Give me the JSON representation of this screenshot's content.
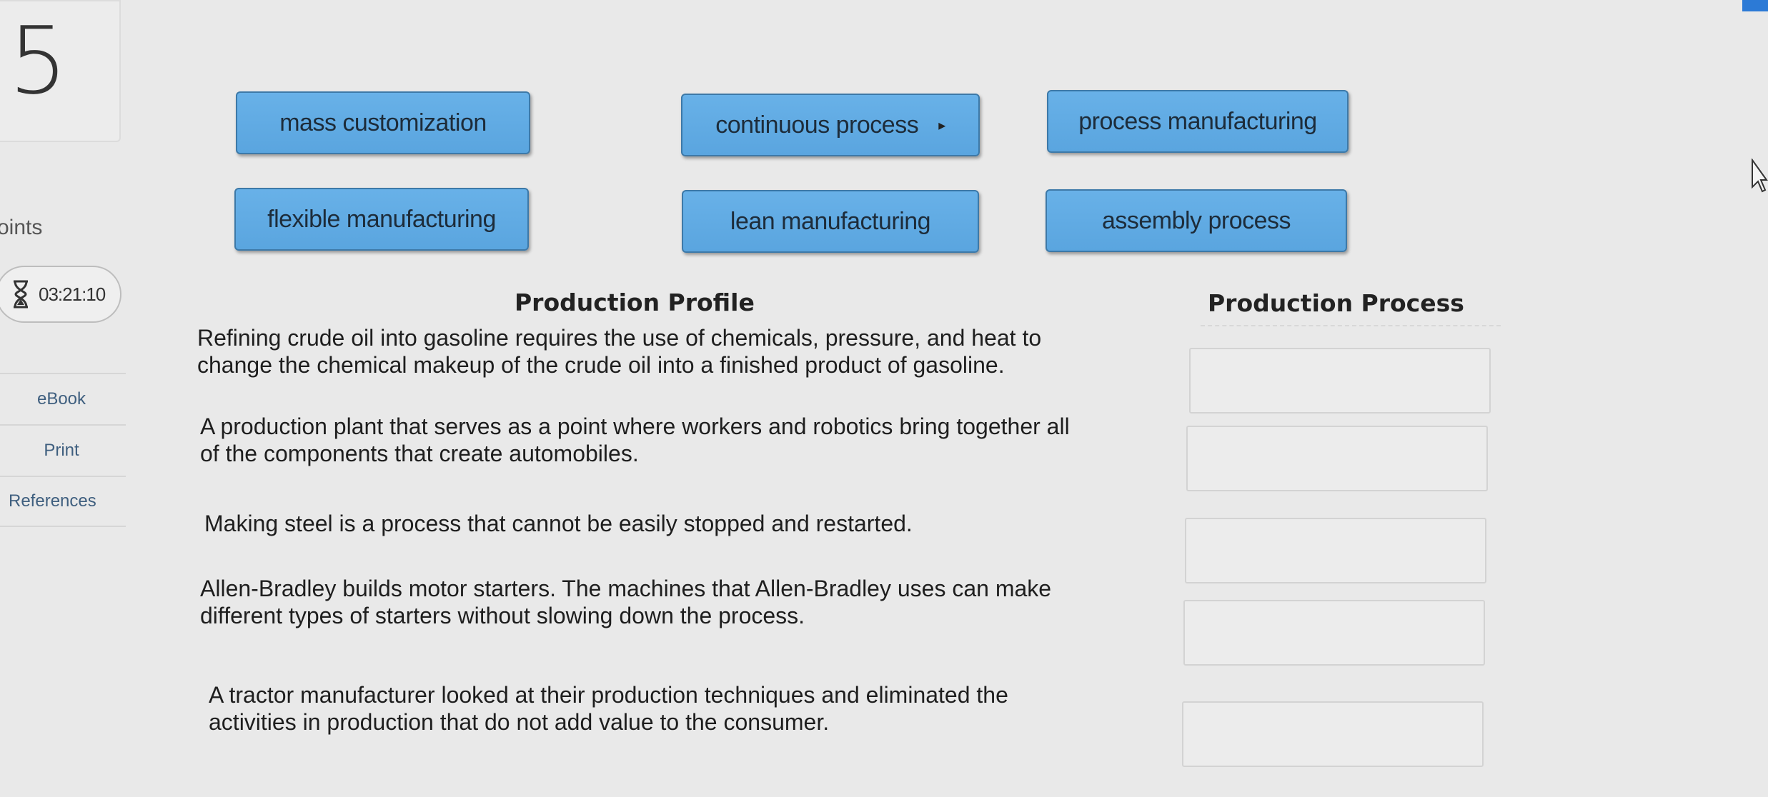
{
  "question": {
    "number": "5"
  },
  "sidebar": {
    "points_label": "oints",
    "timer": "03:21:10",
    "links": [
      "eBook",
      "Print",
      "References"
    ]
  },
  "answer_bank": [
    "mass customization",
    "continuous process",
    "process manufacturing",
    "flexible manufacturing",
    "lean manufacturing",
    "assembly process"
  ],
  "table": {
    "profile_header": "Production Profile",
    "process_header": "Production Process",
    "rows": [
      {
        "line1": "Refining crude oil into gasoline requires the use of chemicals, pressure, and heat to",
        "line2": "change the chemical makeup of the crude oil into a finished product of gasoline."
      },
      {
        "line1": "A production plant that serves as a point where workers and robotics bring together all",
        "line2": "of the components that create automobiles."
      },
      {
        "line1": "Making steel is a process that cannot be easily stopped and restarted.",
        "line2": ""
      },
      {
        "line1": "Allen-Bradley builds motor starters. The machines that Allen-Bradley uses can make",
        "line2": "different types of starters without slowing down the process."
      },
      {
        "line1": "A tractor manufacturer looked at their production techniques and eliminated the",
        "line2": "activities in production that do not add value to the consumer."
      }
    ]
  },
  "colors": {
    "chip_fill": "#5fabe3",
    "chip_border": "#3d79a8",
    "link": "#3f5f7f",
    "background": "#e9e9e9"
  }
}
